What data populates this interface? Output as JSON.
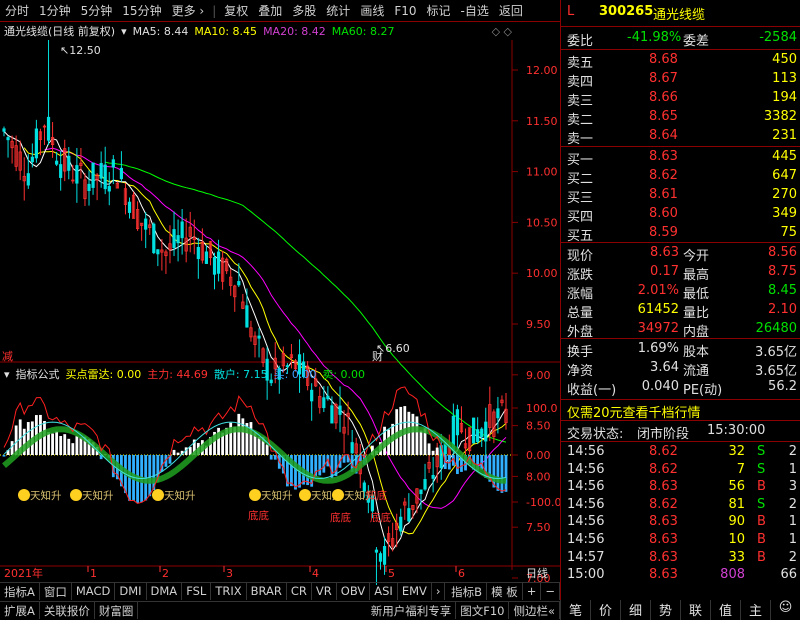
{
  "toolbar": {
    "periods": [
      "分时",
      "1分钟",
      "5分钟",
      "15分钟",
      "更多 ›"
    ],
    "tools": [
      "复权",
      "叠加",
      "多股",
      "统计",
      "画线",
      "F10",
      "标记",
      "-自选",
      "返回"
    ]
  },
  "main_info": {
    "title": "通光线缆(日线 前复权)",
    "ma5": "MA5: 8.44",
    "ma10": "MA10: 8.45",
    "ma20": "MA20: 8.42",
    "ma60": "MA60: 8.27",
    "high_mark": "12.50",
    "low_mark": "6.60",
    "jian": "减",
    "cai": "财"
  },
  "price_axis": [
    "12.00",
    "11.50",
    "11.00",
    "10.50",
    "10.00",
    "9.50",
    "9.00",
    "8.50",
    "8.00",
    "7.50",
    "7.00"
  ],
  "ind_info": {
    "name": "指标公式",
    "buy": "买点雷达: 0.00",
    "main": "主力: 44.69",
    "retail": "散户: 7.15",
    "mai": "买: 0.00",
    "mai2": "卖: 0.00"
  },
  "ind_axis": [
    "100.0",
    "0.00",
    "-100.0"
  ],
  "signals": [
    "天知升",
    "天知升",
    "天知升",
    "天知升",
    "天知升",
    "天知升",
    "知底",
    "底底",
    "底底",
    "底底"
  ],
  "time_axis": {
    "year": "2021年",
    "months": [
      "1",
      "2",
      "3",
      "4",
      "5",
      "6"
    ],
    "period": "日线"
  },
  "tabs_row1": [
    "指标A",
    "窗口",
    "MACD",
    "DMI",
    "DMA",
    "FSL",
    "TRIX",
    "BRAR",
    "CR",
    "VR",
    "OBV",
    "ASI",
    "EMV",
    "›",
    "指标B",
    "模 板",
    "+",
    "−"
  ],
  "tabs_row2": [
    "扩展A",
    "关联报价",
    "财富圈"
  ],
  "tabs_row2_right": [
    "新用户福利专享",
    "图文F10",
    "侧边栏«"
  ],
  "stock": {
    "l": "L",
    "code": "300265",
    "name": "通光线缆"
  },
  "ratio": {
    "label1": "委比",
    "val1": "-41.98%",
    "label2": "委差",
    "val2": "-2584"
  },
  "asks": [
    {
      "label": "卖五",
      "price": "8.68",
      "vol": "450"
    },
    {
      "label": "卖四",
      "price": "8.67",
      "vol": "113"
    },
    {
      "label": "卖三",
      "price": "8.66",
      "vol": "194"
    },
    {
      "label": "卖二",
      "price": "8.65",
      "vol": "3382"
    },
    {
      "label": "卖一",
      "price": "8.64",
      "vol": "231"
    }
  ],
  "bids": [
    {
      "label": "买一",
      "price": "8.63",
      "vol": "445"
    },
    {
      "label": "买二",
      "price": "8.62",
      "vol": "647"
    },
    {
      "label": "买三",
      "price": "8.61",
      "vol": "270"
    },
    {
      "label": "买四",
      "price": "8.60",
      "vol": "349"
    },
    {
      "label": "买五",
      "price": "8.59",
      "vol": "75"
    }
  ],
  "quote": [
    {
      "l1": "现价",
      "v1": "8.63",
      "c1": "up",
      "l2": "今开",
      "v2": "8.56",
      "c2": "up"
    },
    {
      "l1": "涨跌",
      "v1": "0.17",
      "c1": "up",
      "l2": "最高",
      "v2": "8.75",
      "c2": "up"
    },
    {
      "l1": "涨幅",
      "v1": "2.01%",
      "c1": "up",
      "l2": "最低",
      "v2": "8.45",
      "c2": "dn"
    },
    {
      "l1": "总量",
      "v1": "61452",
      "c1": "yl",
      "l2": "量比",
      "v2": "2.10",
      "c2": "up"
    },
    {
      "l1": "外盘",
      "v1": "34972",
      "c1": "up",
      "l2": "内盘",
      "v2": "26480",
      "c2": "dn"
    }
  ],
  "stats": [
    {
      "l1": "换手",
      "v1": "1.69%",
      "l2": "股本",
      "v2": "3.65亿"
    },
    {
      "l1": "净资",
      "v1": "3.64",
      "l2": "流通",
      "v2": "3.65亿"
    },
    {
      "l1": "收益(一)",
      "v1": "0.040",
      "l2": "PE(动)",
      "v2": "56.2"
    }
  ],
  "promo": "仅需20元查看千档行情",
  "trade_status": {
    "label": "交易状态:",
    "state": "闭市阶段",
    "time": "15:30:00"
  },
  "ticks": [
    {
      "t": "14:56",
      "p": "8.62",
      "v": "32",
      "s": "S",
      "n": "2"
    },
    {
      "t": "14:56",
      "p": "8.62",
      "v": "7",
      "s": "S",
      "n": "1"
    },
    {
      "t": "14:56",
      "p": "8.63",
      "v": "56",
      "s": "B",
      "n": "3"
    },
    {
      "t": "14:56",
      "p": "8.62",
      "v": "81",
      "s": "S",
      "n": "2"
    },
    {
      "t": "14:56",
      "p": "8.63",
      "v": "90",
      "s": "B",
      "n": "1"
    },
    {
      "t": "14:56",
      "p": "8.63",
      "v": "10",
      "s": "B",
      "n": "1"
    },
    {
      "t": "14:57",
      "p": "8.63",
      "v": "33",
      "s": "B",
      "n": "2"
    },
    {
      "t": "15:00",
      "p": "8.63",
      "v": "808",
      "s": "",
      "n": "66"
    }
  ],
  "iconbar": [
    "笔",
    "价",
    "细",
    "势",
    "联",
    "值",
    "主",
    "☺"
  ],
  "colors": {
    "up": "#ff3030",
    "down": "#00e000",
    "ma5": "#ffffff",
    "ma10": "#ffff00",
    "ma20": "#ff00ff",
    "ma60": "#00ff00"
  }
}
